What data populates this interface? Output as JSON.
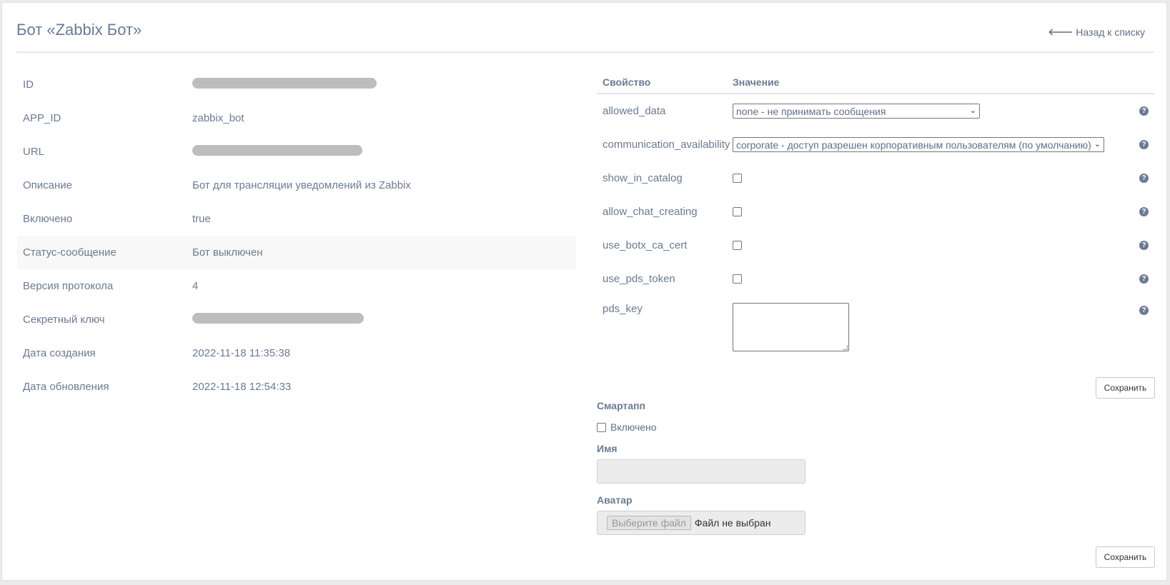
{
  "header": {
    "title": "Бот «Zabbix Бот»",
    "back_label": "Назад к списку"
  },
  "info": [
    {
      "key": "ID",
      "value": "",
      "redacted": true
    },
    {
      "key": "APP_ID",
      "value": "zabbix_bot"
    },
    {
      "key": "URL",
      "value": "",
      "redacted": true
    },
    {
      "key": "Описание",
      "value": "Бот для трансляции уведомлений из Zabbix"
    },
    {
      "key": "Включено",
      "value": "true"
    },
    {
      "key": "Статус-сообщение",
      "value": "Бот выключен"
    },
    {
      "key": "Версия протокола",
      "value": "4"
    },
    {
      "key": "Секретный ключ",
      "value": "",
      "redacted": true
    },
    {
      "key": "Дата создания",
      "value": "2022-11-18 11:35:38"
    },
    {
      "key": "Дата обновления",
      "value": "2022-11-18 12:54:33"
    }
  ],
  "props": {
    "col_property": "Свойство",
    "col_value": "Значение",
    "rows": [
      {
        "name": "allowed_data",
        "type": "select",
        "value": "none - не принимать сообщения"
      },
      {
        "name": "communication_availability",
        "type": "select",
        "value": "corporate - доступ разрешен корпоративным пользователям (по умолчанию)"
      },
      {
        "name": "show_in_catalog",
        "type": "checkbox",
        "checked": false
      },
      {
        "name": "allow_chat_creating",
        "type": "checkbox",
        "checked": false
      },
      {
        "name": "use_botx_ca_cert",
        "type": "checkbox",
        "checked": false
      },
      {
        "name": "use_pds_token",
        "type": "checkbox",
        "checked": false
      },
      {
        "name": "pds_key",
        "type": "textarea",
        "value": ""
      }
    ],
    "save_label": "Сохранить"
  },
  "smartapp": {
    "title": "Смартапп",
    "enabled_label": "Включено",
    "enabled": false,
    "name_label": "Имя",
    "name_value": "",
    "avatar_label": "Аватар",
    "file_button": "Выберите файл",
    "file_status": "Файл не выбран",
    "save_label": "Сохранить"
  },
  "colors": {
    "text": "#5f6f8a",
    "background": "#ebebeb",
    "panel": "#ffffff"
  }
}
